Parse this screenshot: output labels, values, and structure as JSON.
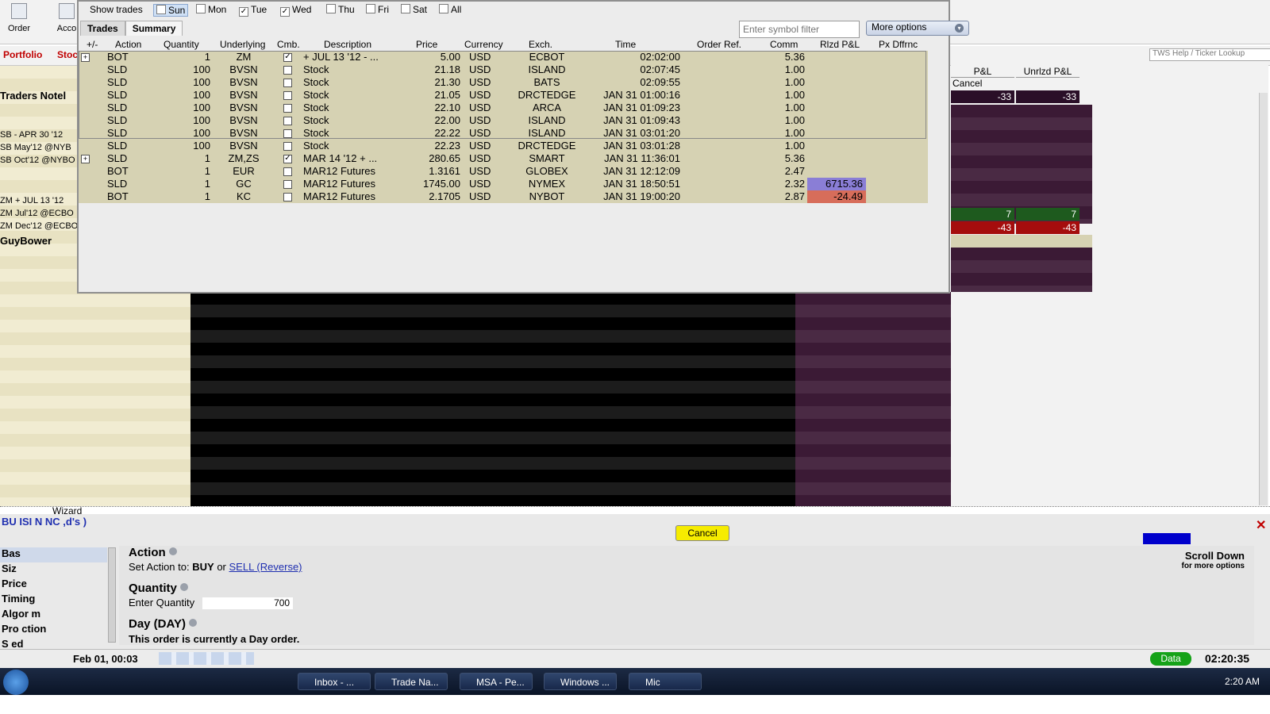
{
  "toolbar": {
    "order_label": "Order",
    "account_label": "Acco"
  },
  "bg_tabs": {
    "portfolio": "Portfolio",
    "stock": "Stoc"
  },
  "left_panel": {
    "title": "Traders Notel",
    "rows": [
      "SB - APR 30 '12",
      "SB May'12 @NYB",
      "SB Oct'12 @NYBO",
      "ZM + JUL 13 '12",
      "ZM Jul'12 @ECBO",
      "ZM Dec'12 @ECBO"
    ],
    "footer": "GuyBower"
  },
  "right_panel": {
    "search_placeholder": "TWS Help / Ticker Lookup",
    "col_pnl": "P&L",
    "col_unrlzd": "Unrlzd P&L",
    "cancel": "Cancel",
    "row1": {
      "pnl": "-33",
      "unrlzd": "-33"
    },
    "row2": {
      "pnl": "7",
      "unrlzd": "7"
    },
    "row3": {
      "pnl": "-43",
      "unrlzd": "-43"
    }
  },
  "trades_window": {
    "show_trades_label": "Show trades",
    "days": [
      {
        "label": "Sun",
        "checked": ""
      },
      {
        "label": "Mon",
        "checked": ""
      },
      {
        "label": "Tue",
        "checked": "✓"
      },
      {
        "label": "Wed",
        "checked": "✓"
      },
      {
        "label": "Thu",
        "checked": ""
      },
      {
        "label": "Fri",
        "checked": ""
      },
      {
        "label": "Sat",
        "checked": ""
      },
      {
        "label": "All",
        "checked": ""
      }
    ],
    "tabs": [
      "Trades",
      "Summary"
    ],
    "filter_placeholder": "Enter symbol filter",
    "more_options": "More options",
    "headers": {
      "pm": "+/-",
      "action": "Action",
      "quantity": "Quantity",
      "underlying": "Underlying",
      "cmb": "Cmb.",
      "description": "Description",
      "price": "Price",
      "currency": "Currency",
      "exch": "Exch.",
      "time": "Time",
      "order_ref": "Order Ref.",
      "comm": "Comm",
      "rlzd": "Rlzd P&L",
      "px": "Px Dffrnc"
    },
    "rows": [
      {
        "pm": "+",
        "action": "BOT",
        "qty": "1",
        "und": "ZM",
        "cmb": "✓",
        "desc": "+ JUL 13 '12 - ...",
        "price": "5.00",
        "cur": "USD",
        "exch": "ECBOT",
        "time": "02:02:00",
        "comm": "5.36",
        "rlzd": ""
      },
      {
        "pm": "",
        "action": "SLD",
        "qty": "100",
        "und": "BVSN",
        "cmb": "",
        "desc": "Stock",
        "price": "21.18",
        "cur": "USD",
        "exch": "ISLAND",
        "time": "02:07:45",
        "comm": "1.00",
        "rlzd": ""
      },
      {
        "pm": "",
        "action": "SLD",
        "qty": "100",
        "und": "BVSN",
        "cmb": "",
        "desc": "Stock",
        "price": "21.30",
        "cur": "USD",
        "exch": "BATS",
        "time": "02:09:55",
        "comm": "1.00",
        "rlzd": ""
      },
      {
        "pm": "",
        "action": "SLD",
        "qty": "100",
        "und": "BVSN",
        "cmb": "",
        "desc": "Stock",
        "price": "21.05",
        "cur": "USD",
        "exch": "DRCTEDGE",
        "time": "JAN 31 01:00:16",
        "comm": "1.00",
        "rlzd": ""
      },
      {
        "pm": "",
        "action": "SLD",
        "qty": "100",
        "und": "BVSN",
        "cmb": "",
        "desc": "Stock",
        "price": "22.10",
        "cur": "USD",
        "exch": "ARCA",
        "time": "JAN 31 01:09:23",
        "comm": "1.00",
        "rlzd": ""
      },
      {
        "pm": "",
        "action": "SLD",
        "qty": "100",
        "und": "BVSN",
        "cmb": "",
        "desc": "Stock",
        "price": "22.00",
        "cur": "USD",
        "exch": "ISLAND",
        "time": "JAN 31 01:09:43",
        "comm": "1.00",
        "rlzd": ""
      },
      {
        "pm": "",
        "action": "SLD",
        "qty": "100",
        "und": "BVSN",
        "cmb": "",
        "desc": "Stock",
        "price": "22.22",
        "cur": "USD",
        "exch": "ISLAND",
        "time": "JAN 31 03:01:20",
        "comm": "1.00",
        "rlzd": ""
      },
      {
        "pm": "",
        "action": "SLD",
        "qty": "100",
        "und": "BVSN",
        "cmb": "",
        "desc": "Stock",
        "price": "22.23",
        "cur": "USD",
        "exch": "DRCTEDGE",
        "time": "JAN 31 03:01:28",
        "comm": "1.00",
        "rlzd": ""
      },
      {
        "pm": "+",
        "action": "SLD",
        "qty": "1",
        "und": "ZM,ZS",
        "cmb": "✓",
        "desc": "MAR 14 '12 + ...",
        "price": "280.65",
        "cur": "USD",
        "exch": "SMART",
        "time": "JAN 31 11:36:01",
        "comm": "5.36",
        "rlzd": ""
      },
      {
        "pm": "",
        "action": "BOT",
        "qty": "1",
        "und": "EUR",
        "cmb": "",
        "desc": "MAR12 Futures",
        "price": "1.3161",
        "cur": "USD",
        "exch": "GLOBEX",
        "time": "JAN 31 12:12:09",
        "comm": "2.47",
        "rlzd": ""
      },
      {
        "pm": "",
        "action": "SLD",
        "qty": "1",
        "und": "GC",
        "cmb": "",
        "desc": "MAR12 Futures",
        "price": "1745.00",
        "cur": "USD",
        "exch": "NYMEX",
        "time": "JAN 31 18:50:51",
        "comm": "2.32",
        "rlzd": "6715.36"
      },
      {
        "pm": "",
        "action": "BOT",
        "qty": "1",
        "und": "KC",
        "cmb": "",
        "desc": "MAR12 Futures",
        "price": "2.1705",
        "cur": "USD",
        "exch": "NYBOT",
        "time": "JAN 31 19:00:20",
        "comm": "2.87",
        "rlzd": "-24.49"
      }
    ]
  },
  "wizard": {
    "title_fragment": "Wizard",
    "order_title": "BU ISI N NC ,d's )",
    "cancel": "Cancel",
    "nav": [
      "Bas",
      "Siz",
      "Price",
      "Timing",
      "Algor m",
      "Pro ction",
      "S ed"
    ],
    "action_title": "Action",
    "action_text": "Set Action to:",
    "action_buy": "BUY",
    "action_or": "or",
    "action_sell": "SELL (Reverse)",
    "quantity_title": "Quantity",
    "quantity_label": "Enter Quantity",
    "quantity_value": "700",
    "day_title": "Day (DAY)",
    "day_text": "This order is currently a Day order.",
    "scroll_down": "Scroll Down",
    "scroll_sub": "for more options"
  },
  "status_bar": {
    "date": "Feb 01, 00:03",
    "data": "Data",
    "clock": "02:20:35"
  },
  "taskbar": {
    "tasks": [
      "Inbox - ...",
      "Trade Na...",
      "MSA - Pe...",
      "Windows ...",
      "Mic"
    ],
    "time": "2:20 AM"
  }
}
